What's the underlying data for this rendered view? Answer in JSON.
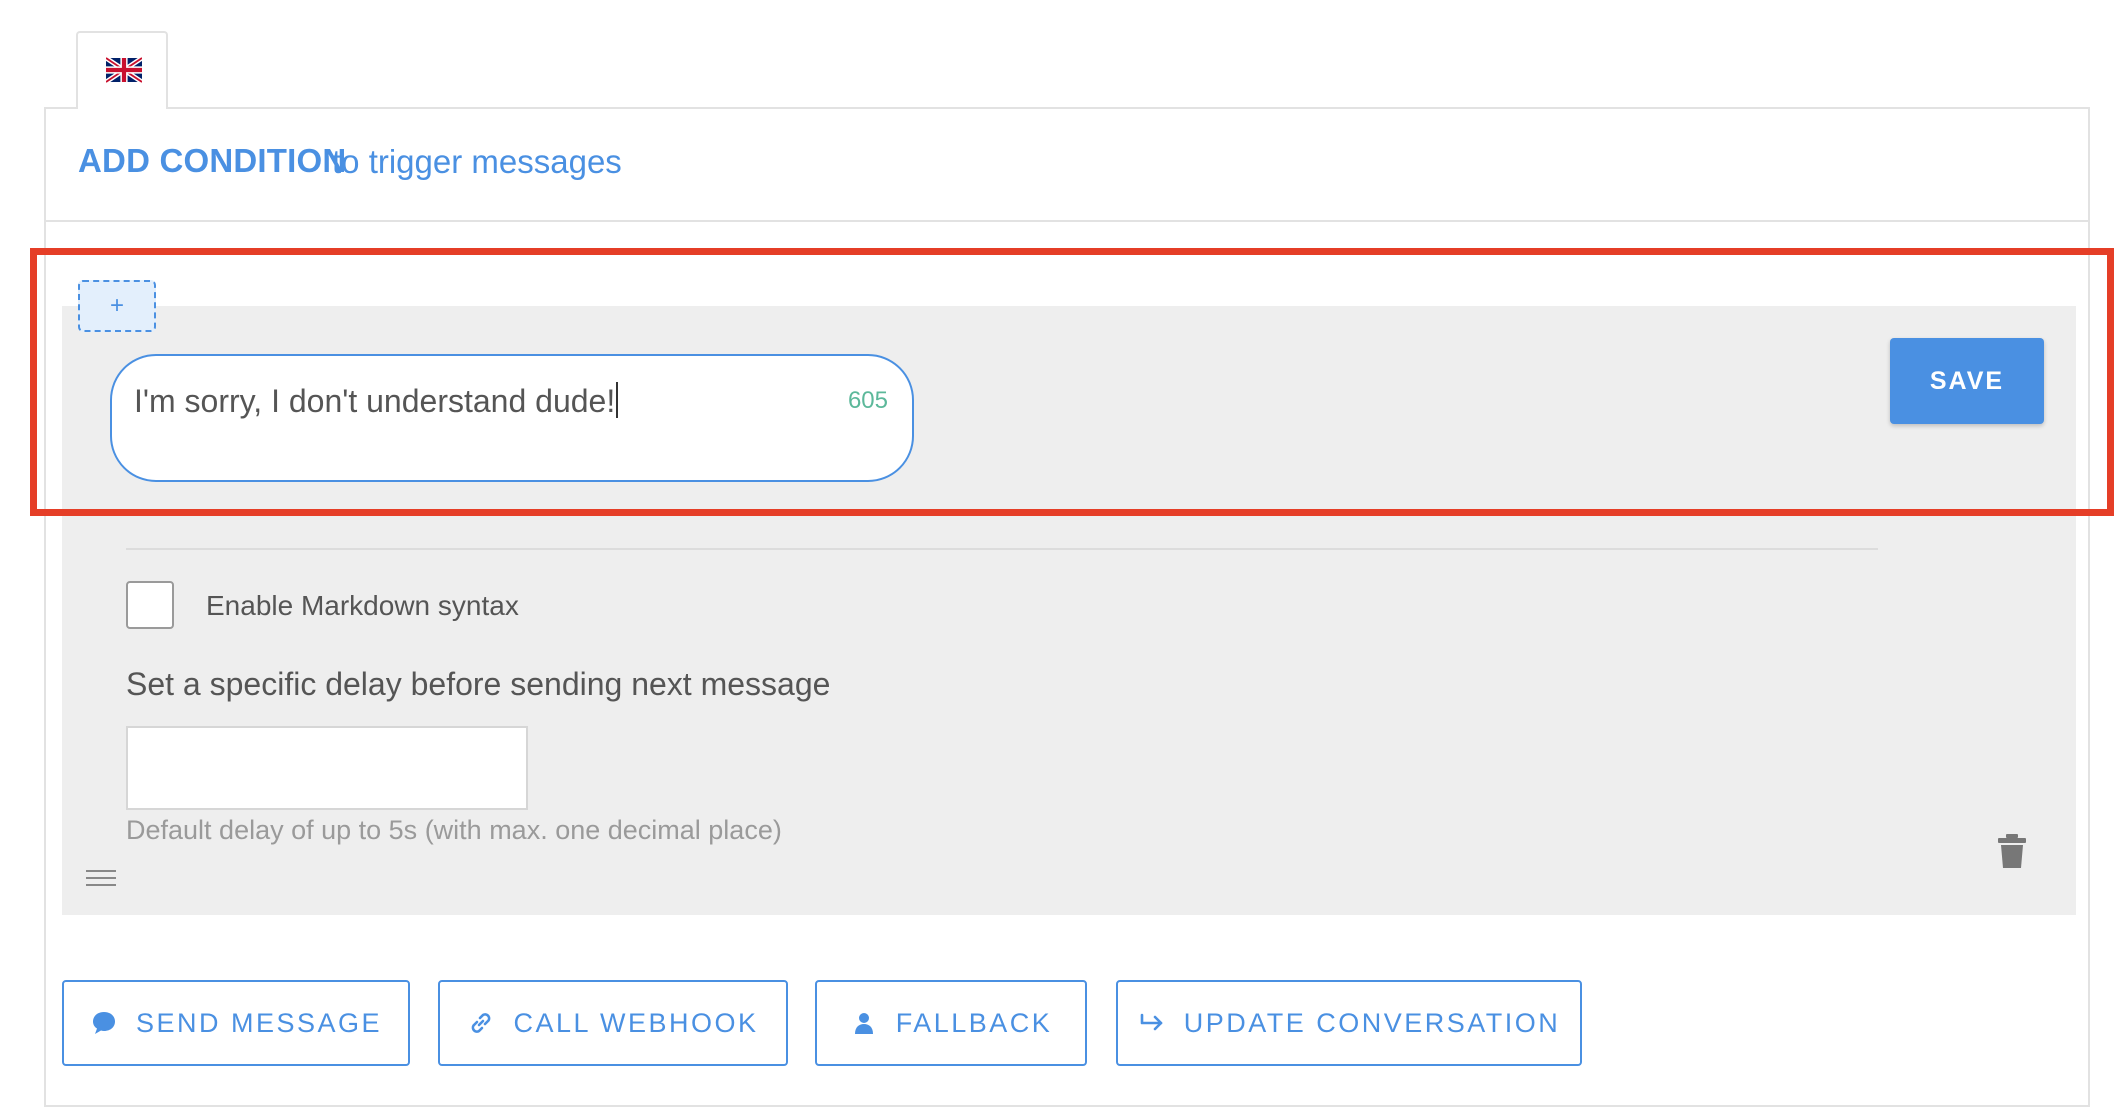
{
  "header": {
    "title": "ADD CONDITION",
    "subtitle": "to trigger messages"
  },
  "language_tab": {
    "icon": "uk-flag-icon"
  },
  "message": {
    "add_button": "+",
    "text": "I'm sorry, I don't understand dude!",
    "char_count": "605",
    "save_label": "SAVE"
  },
  "options": {
    "markdown_label": "Enable Markdown syntax",
    "markdown_checked": false,
    "delay_label": "Set a specific delay before sending next message",
    "delay_value": "",
    "delay_help": "Default delay of up to 5s (with max. one decimal place)"
  },
  "actions": [
    {
      "label": "SEND MESSAGE",
      "icon": "chat-bubble-icon"
    },
    {
      "label": "CALL WEBHOOK",
      "icon": "link-icon"
    },
    {
      "label": "FALLBACK",
      "icon": "person-icon"
    },
    {
      "label": "UPDATE CONVERSATION",
      "icon": "arrow-right-icon"
    }
  ],
  "colors": {
    "accent": "#4a90e2",
    "highlight": "#e53e27",
    "counter": "#5cb89a",
    "block_bg": "#eeeeee"
  }
}
